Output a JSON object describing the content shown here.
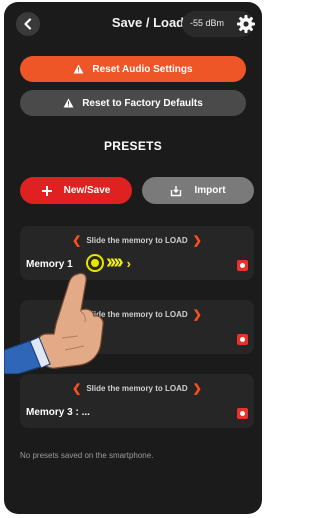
{
  "header": {
    "title": "Save / Load",
    "signal": "-55 dBm",
    "back_icon": "chevron-left-icon",
    "settings_icon": "gear-icon"
  },
  "buttons": {
    "reset_audio": "Reset Audio Settings",
    "reset_factory": "Reset to Factory Defaults",
    "new_save": "New/Save",
    "import": "Import"
  },
  "presets_heading": "PRESETS",
  "slots": [
    {
      "hint": "Slide the memory to LOAD",
      "name": "Memory 1"
    },
    {
      "hint": "Slide the memory to LOAD",
      "name": ": ..."
    },
    {
      "hint": "Slide the memory to LOAD",
      "name": "Memory 3  : ..."
    }
  ],
  "no_presets_text": "No presets saved on the smartphone.",
  "colors": {
    "background": "#1b1b1b",
    "accent": "#ee5527",
    "danger": "#e02121",
    "slider": "#f3f300"
  }
}
